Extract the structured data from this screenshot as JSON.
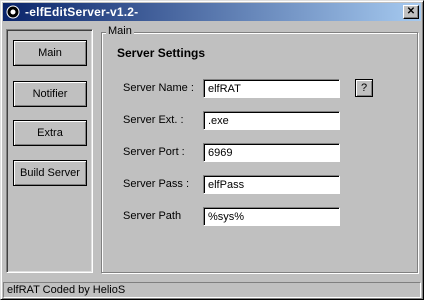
{
  "window": {
    "title": "-elfEditServer-v1.2-",
    "close_glyph": "✕",
    "icon": "app-icon"
  },
  "nav": {
    "items": [
      {
        "label": "Main"
      },
      {
        "label": "Notifier"
      },
      {
        "label": "Extra"
      },
      {
        "label": "Build Server"
      }
    ]
  },
  "main": {
    "group_caption": "Main",
    "section_title": "Server Settings",
    "help_label": "?",
    "fields": [
      {
        "label": "Server Name :",
        "value": "elfRAT"
      },
      {
        "label": "Server Ext. :",
        "value": ".exe"
      },
      {
        "label": "Server Port :",
        "value": "6969"
      },
      {
        "label": "Server Pass :",
        "value": "elfPass"
      },
      {
        "label": "Server Path",
        "value": "%sys%"
      }
    ]
  },
  "status": {
    "text": "elfRAT Coded by HelioS"
  },
  "colors": {
    "titlebar_start": "#0a246a",
    "titlebar_end": "#a6caf0",
    "face": "#c0c0c0"
  }
}
